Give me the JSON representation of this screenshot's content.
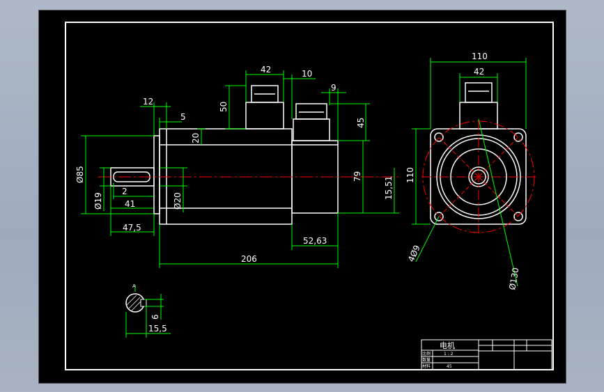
{
  "drawing": {
    "colors": {
      "background": "#000000",
      "outline": "#ffffff",
      "dimension": "#00ff00",
      "centerline": "#ff0000",
      "text": "#ffffff"
    },
    "dimensions": {
      "d42_top": "42",
      "d10": "10",
      "d9": "9",
      "d12": "12",
      "d5": "5",
      "d50": "50",
      "d45": "45",
      "d20_top": "20",
      "d79": "79",
      "d1551": "15,51",
      "dia85": "Ø85",
      "dia19": "Ø19",
      "d2": "2",
      "d41": "41",
      "dia20": "Ø20",
      "d475": "47,5",
      "d5263": "52,63",
      "d206": "206",
      "d110_top": "110",
      "d42_side": "42",
      "d110_side": "110",
      "holes": "4Ø9",
      "dia130": "Ø130",
      "d6": "6",
      "d155": "15,5",
      "section_mark": "A"
    },
    "title_block": {
      "title": "电机",
      "row1_label": "比例",
      "row1_value": "1 : 2",
      "row2_label": "数量",
      "row3_label": "材料",
      "row3_value": "45"
    }
  }
}
